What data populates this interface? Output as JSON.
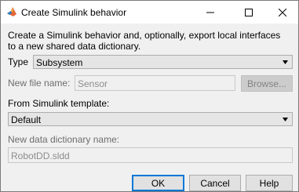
{
  "window": {
    "title": "Create Simulink behavior",
    "icon": "matlab-logo-icon"
  },
  "description": "Create a Simulink behavior and, optionally, export local interfaces to a new shared data dictionary.",
  "type_field": {
    "label": "Type",
    "value": "Subsystem"
  },
  "file_name_field": {
    "label": "New file name:",
    "value": "Sensor",
    "browse_label": "Browse..."
  },
  "template_field": {
    "label": "From Simulink template:",
    "value": "Default"
  },
  "dictionary_field": {
    "label": "New data dictionary name:",
    "value": "RobotDD.sldd"
  },
  "buttons": {
    "ok": "OK",
    "cancel": "Cancel",
    "help": "Help"
  },
  "colors": {
    "accent": "#0078d7",
    "dialog_bg": "#f0f0f0"
  }
}
